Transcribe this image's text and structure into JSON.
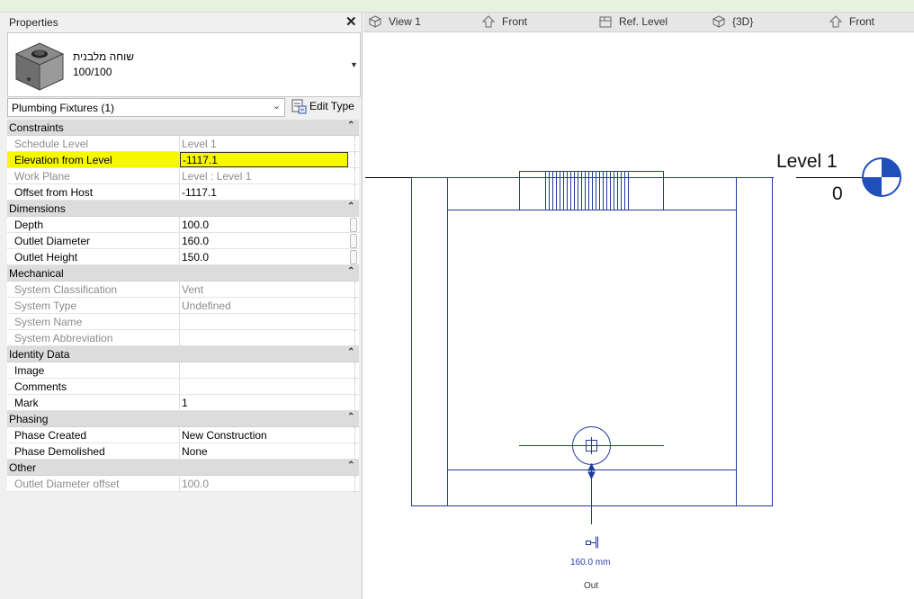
{
  "properties": {
    "title": "Properties",
    "type_name": "שוחה מלבנית",
    "type_size": "100/100",
    "selector": "Plumbing Fixtures (1)",
    "edit_type": "Edit Type",
    "groups": [
      {
        "label": "Constraints",
        "rows": [
          {
            "name": "Schedule Level",
            "value": "Level 1",
            "readonly": true
          },
          {
            "name": "Elevation from Level",
            "value": "-1117.1",
            "highlight": true
          },
          {
            "name": "Work Plane",
            "value": "Level : Level 1",
            "readonly": true
          },
          {
            "name": "Offset from Host",
            "value": "-1117.1"
          }
        ]
      },
      {
        "label": "Dimensions",
        "rows": [
          {
            "name": "Depth",
            "value": "100.0"
          },
          {
            "name": "Outlet Diameter",
            "value": "160.0"
          },
          {
            "name": "Outlet Height",
            "value": "150.0"
          }
        ]
      },
      {
        "label": "Mechanical",
        "rows": [
          {
            "name": "System Classification",
            "value": "Vent",
            "readonly": true
          },
          {
            "name": "System Type",
            "value": "Undefined",
            "readonly": true
          },
          {
            "name": "System Name",
            "value": "",
            "readonly": true
          },
          {
            "name": "System Abbreviation",
            "value": "",
            "readonly": true
          }
        ]
      },
      {
        "label": "Identity Data",
        "rows": [
          {
            "name": "Image",
            "value": ""
          },
          {
            "name": "Comments",
            "value": ""
          },
          {
            "name": "Mark",
            "value": "1"
          }
        ]
      },
      {
        "label": "Phasing",
        "rows": [
          {
            "name": "Phase Created",
            "value": "New Construction"
          },
          {
            "name": "Phase Demolished",
            "value": "None"
          }
        ]
      },
      {
        "label": "Other",
        "rows": [
          {
            "name": "Outlet Diameter offset",
            "value": "100.0",
            "readonly": true
          }
        ]
      }
    ]
  },
  "tabs": [
    {
      "label": "View 1",
      "icon": "3d-view-icon"
    },
    {
      "label": "Front",
      "icon": "elevation-icon"
    },
    {
      "label": "Ref. Level",
      "icon": "plan-view-icon"
    },
    {
      "label": "{3D}",
      "icon": "3d-view-icon"
    },
    {
      "label": "Front",
      "icon": "elevation-icon"
    }
  ],
  "drawing": {
    "level_name": "Level 1",
    "level_value": "0",
    "outlet_dimension": "160.0 mm",
    "connector_label": "Out",
    "line_color": "#1f3a9a"
  }
}
